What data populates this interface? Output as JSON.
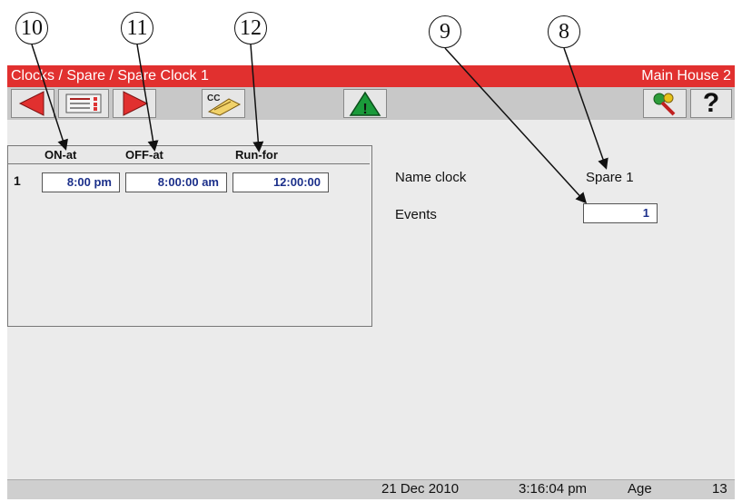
{
  "callouts": [
    "10",
    "11",
    "12",
    "9",
    "8"
  ],
  "titlebar": {
    "left": "Clocks / Spare / Spare Clock 1",
    "right": "Main House 2",
    "color": "#e1302f"
  },
  "toolbar": {
    "icons": [
      "back-arrow-icon",
      "clock-schedule-icon",
      "forward-arrow-icon",
      "cc-copy-icon",
      "warning-icon",
      "keys-icon",
      "help-icon"
    ],
    "cc_label": "CC",
    "help_label": "?"
  },
  "table": {
    "headers": [
      "ON-at",
      "OFF-at",
      "Run-for"
    ],
    "rows": [
      {
        "num": "1",
        "on": "8:00 pm",
        "off": "8:00:00 am",
        "run": "12:00:00"
      }
    ]
  },
  "settings": {
    "name_label": "Name clock",
    "name_value": "Spare 1",
    "events_label": "Events",
    "events_value": "1"
  },
  "status": {
    "date": "21 Dec 2010",
    "time": "3:16:04 pm",
    "age_label": "Age",
    "age_value": "13"
  }
}
